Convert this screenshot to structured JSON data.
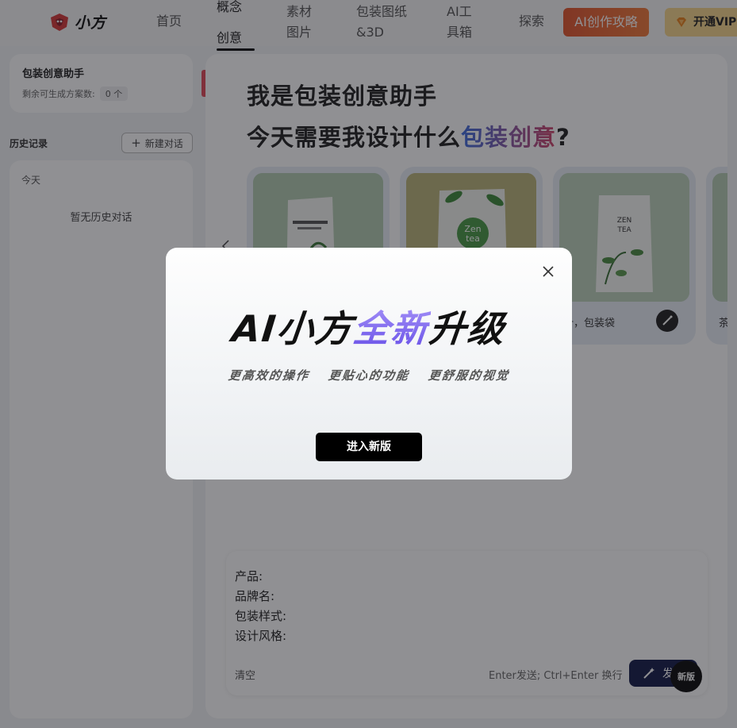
{
  "header": {
    "logo_text": "小方",
    "nav": {
      "home": "首页",
      "concept_line1": "概念",
      "concept_line2": "创意",
      "material_line1": "素材",
      "material_line2": "图片",
      "pack_line1": "包装图纸",
      "pack_line2": "&3D",
      "ai_line1": "AI工",
      "ai_line2": "具箱",
      "explore": "探索"
    },
    "guide_button": "AI创作攻略",
    "vip_button": "开通VIP",
    "accent_color": "#e2572f"
  },
  "sidebar": {
    "assistant_title": "包装创意助手",
    "remaining_label": "剩余可生成方案数:",
    "remaining_count": "0 个",
    "history_label": "历史记录",
    "new_chat_label": "新建对话",
    "today_label": "今天",
    "empty_label": "暂无历史对话"
  },
  "main": {
    "headline_1": "我是包装创意助手",
    "headline_2_prefix": "今天需要我设计什么",
    "headline_2_highlight": "包装创意",
    "headline_2_suffix": "?",
    "cards": [
      {
        "caption": ""
      },
      {
        "caption": ""
      },
      {
        "caption": "茶叶，包装袋"
      },
      {
        "caption": "茶"
      }
    ],
    "form": {
      "product": "产品:",
      "brand": "品牌名:",
      "style": "包装样式:",
      "design": "设计风格:"
    },
    "clear_label": "清空",
    "shortcut_hint": "Enter发送; Ctrl+Enter 换行",
    "send_label": "发",
    "new_version_badge": "新版"
  },
  "modal": {
    "title_prefix": "AI小方",
    "title_accent": "全新",
    "title_suffix": "升级",
    "features": [
      "更高效的操作",
      "更贴心的功能",
      "更舒服的视觉"
    ],
    "enter_button": "进入新版",
    "accent_color": "#7b63ef"
  }
}
